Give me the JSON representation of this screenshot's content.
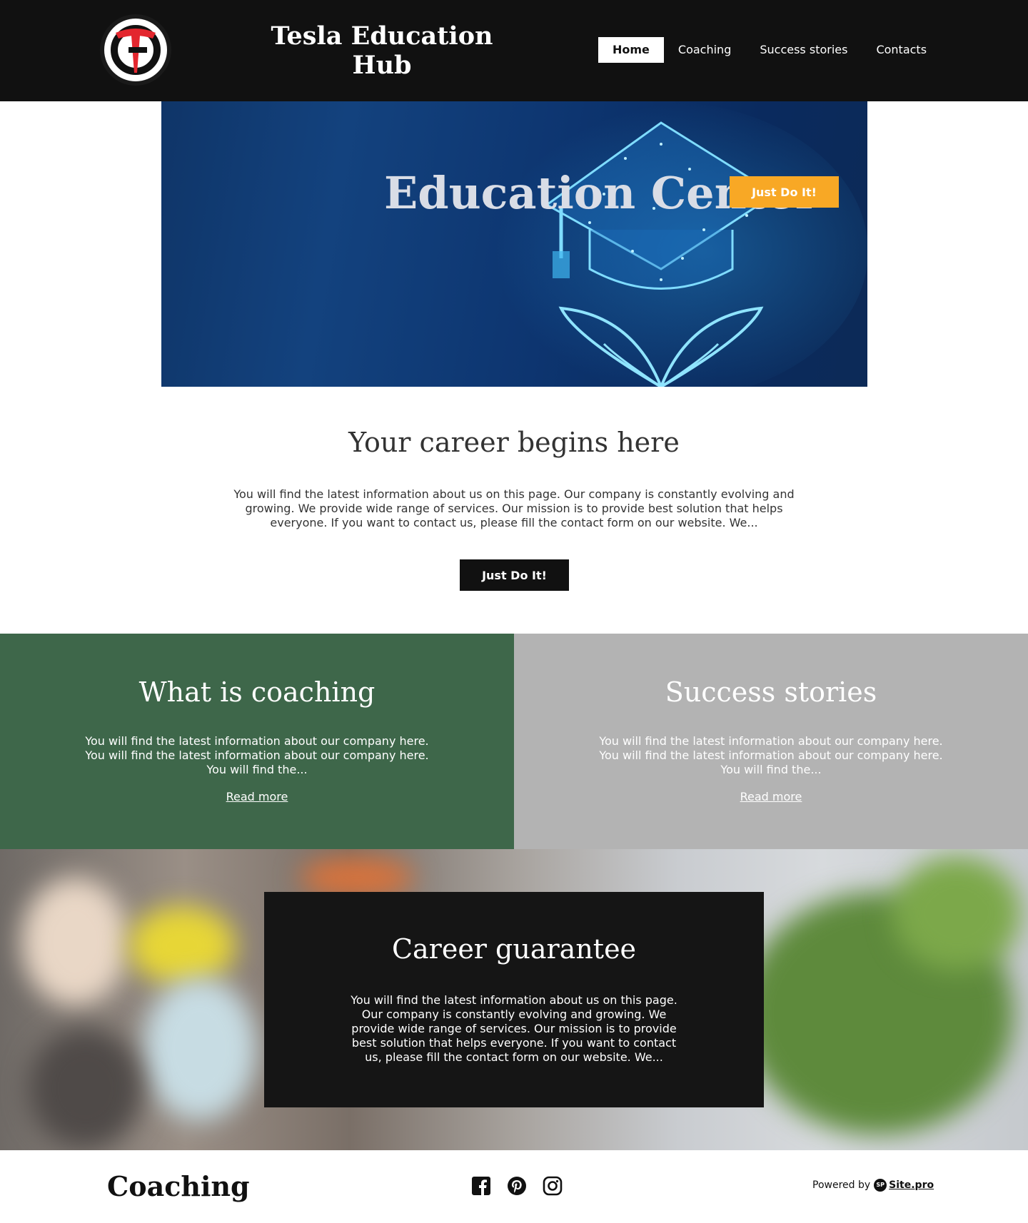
{
  "header": {
    "site_title": "Tesla Education Hub",
    "nav": [
      "Home",
      "Coaching",
      "Success stories",
      "Contacts"
    ],
    "active_nav": "Home"
  },
  "hero": {
    "title": "Education Center",
    "button_label": "Just Do It!"
  },
  "career": {
    "heading": "Your career begins here",
    "text": "You will find the latest information about us on this page. Our company is constantly evolving and growing. We provide wide range of services. Our mission is to provide best solution that helps everyone. If you want to contact us, please fill the contact form on our website. We...",
    "button_label": "Just Do It!"
  },
  "panels": [
    {
      "title": "What is coaching",
      "text": "You will find the latest information about our company here. You will find the latest information about our company here. You will find the...",
      "link": "Read more",
      "color": "#3e674a"
    },
    {
      "title": "Success stories",
      "text": "You will find the latest information about our company here. You will find the latest information about our company here. You will find the...",
      "link": "Read more",
      "color": "#b3b3b3"
    }
  ],
  "guarantee": {
    "title": "Career guarantee",
    "text": "You will find the latest information about us on this page. Our company is constantly evolving and growing. We provide wide range of services. Our mission is to provide best solution that helps everyone. If you want to contact us, please fill the contact form on our website. We..."
  },
  "footer": {
    "title": "Coaching",
    "social_icons": [
      "facebook-icon",
      "pinterest-icon",
      "instagram-icon"
    ],
    "powered_by": "Powered by",
    "brand": "Site.pro"
  },
  "colors": {
    "accent_orange": "#f8a825",
    "header_bg": "#111111",
    "logo_red": "#e3262e"
  }
}
